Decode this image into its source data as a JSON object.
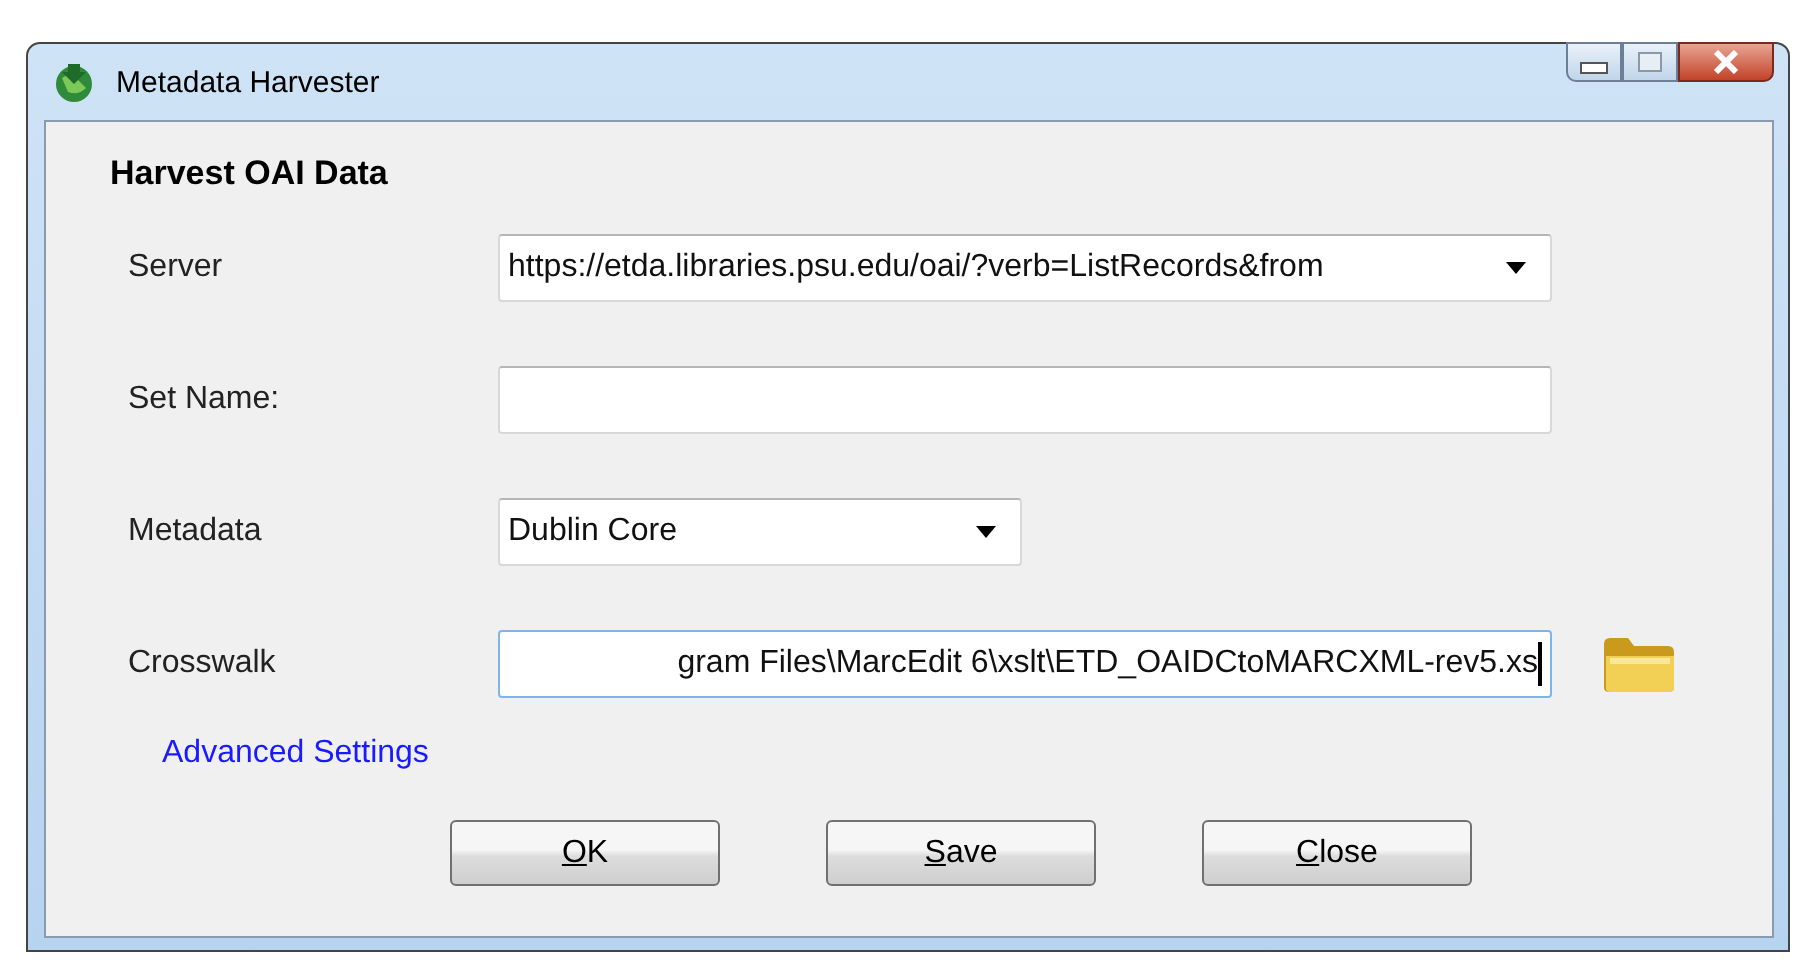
{
  "window": {
    "title": "Metadata Harvester"
  },
  "section_title": "Harvest OAI Data",
  "fields": [
    {
      "kind": "dropdown",
      "label": "Server",
      "value": "https://etda.libraries.psu.edu/oai/?verb=ListRecords&from",
      "focused": false
    },
    {
      "kind": "text",
      "label": "Set Name:",
      "focused": false
    },
    {
      "kind": "dropdown-short",
      "label": "Metadata",
      "value": "Dublin Core",
      "focused": false
    },
    {
      "kind": "file",
      "label": "Crosswalk",
      "value": "gram Files\\MarcEdit 6\\xslt\\ETD_OAIDCtoMARCXML-rev5.xs",
      "focused": true
    }
  ],
  "link": "Advanced Settings",
  "buttons": [
    {
      "label": "OK"
    },
    {
      "label": "Save"
    },
    {
      "label": "Close"
    }
  ]
}
